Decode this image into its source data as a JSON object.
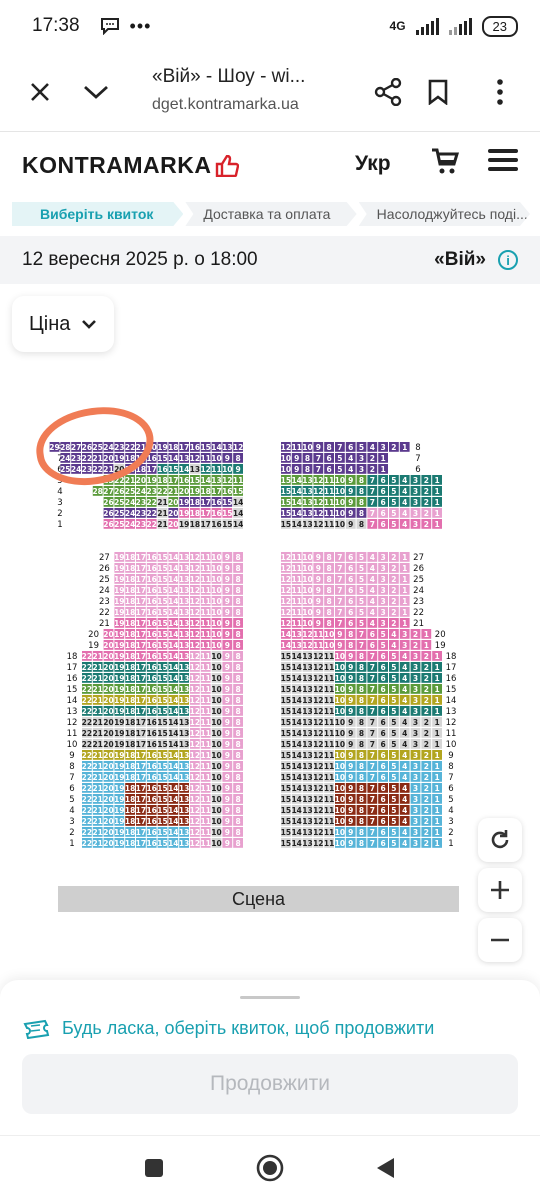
{
  "status": {
    "time": "17:38",
    "network": "4G",
    "battery": "23"
  },
  "browser": {
    "title": "«Вій» - Шоу - wi...",
    "url": "dget.kontramarka.ua"
  },
  "site": {
    "logo": "KONTRAMARKA",
    "lang": "Укр"
  },
  "steps": [
    "Виберіть квиток",
    "Доставка та оплата",
    "Насолоджуйтесь поді..."
  ],
  "event": {
    "date": "12 вересня 2025 р. о 18:00",
    "show": "«Вій»",
    "info_icon": "i"
  },
  "price_filter": {
    "label": "Ціна"
  },
  "colors": {
    "purple": "#5b3a8e",
    "pink": "#e36fae",
    "lightpink": "#e8a1cf",
    "teal": "#1b7a72",
    "green": "#5a9a3a",
    "olive": "#b2a51f",
    "lightblue": "#56b4d8",
    "darkred": "#8a2a14",
    "gray": "#d6d6d6",
    "dark": "#333333",
    "orange": "#f07c55"
  },
  "stage": {
    "label": "Сцена"
  },
  "sheet": {
    "hint": "Будь ласка, оберіть квиток, щоб продовжити",
    "continue": "Продовжити"
  }
}
